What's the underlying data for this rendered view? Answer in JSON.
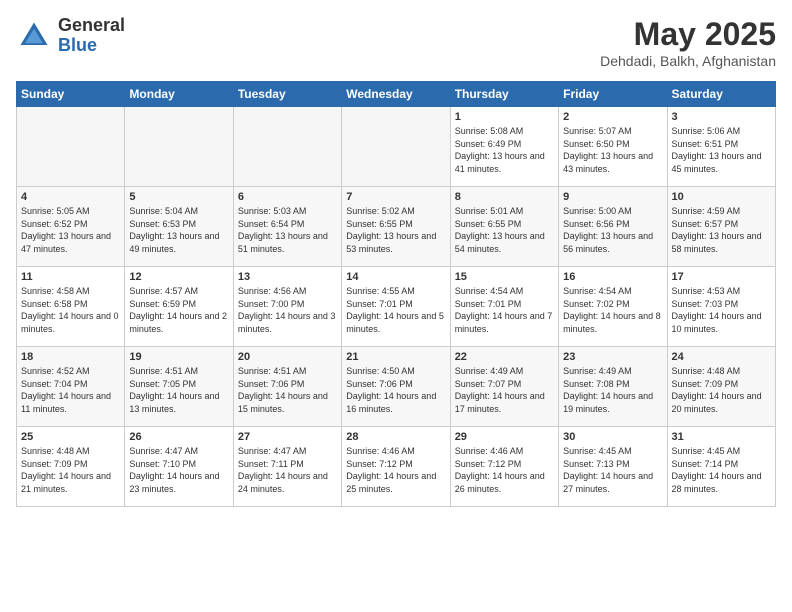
{
  "header": {
    "logo_general": "General",
    "logo_blue": "Blue",
    "title": "May 2025",
    "subtitle": "Dehdadi, Balkh, Afghanistan"
  },
  "weekdays": [
    "Sunday",
    "Monday",
    "Tuesday",
    "Wednesday",
    "Thursday",
    "Friday",
    "Saturday"
  ],
  "weeks": [
    [
      {
        "day": "",
        "empty": true
      },
      {
        "day": "",
        "empty": true
      },
      {
        "day": "",
        "empty": true
      },
      {
        "day": "",
        "empty": true
      },
      {
        "day": "1",
        "sunrise": "5:08 AM",
        "sunset": "6:49 PM",
        "daylight": "13 hours and 41 minutes."
      },
      {
        "day": "2",
        "sunrise": "5:07 AM",
        "sunset": "6:50 PM",
        "daylight": "13 hours and 43 minutes."
      },
      {
        "day": "3",
        "sunrise": "5:06 AM",
        "sunset": "6:51 PM",
        "daylight": "13 hours and 45 minutes."
      }
    ],
    [
      {
        "day": "4",
        "sunrise": "5:05 AM",
        "sunset": "6:52 PM",
        "daylight": "13 hours and 47 minutes."
      },
      {
        "day": "5",
        "sunrise": "5:04 AM",
        "sunset": "6:53 PM",
        "daylight": "13 hours and 49 minutes."
      },
      {
        "day": "6",
        "sunrise": "5:03 AM",
        "sunset": "6:54 PM",
        "daylight": "13 hours and 51 minutes."
      },
      {
        "day": "7",
        "sunrise": "5:02 AM",
        "sunset": "6:55 PM",
        "daylight": "13 hours and 53 minutes."
      },
      {
        "day": "8",
        "sunrise": "5:01 AM",
        "sunset": "6:55 PM",
        "daylight": "13 hours and 54 minutes."
      },
      {
        "day": "9",
        "sunrise": "5:00 AM",
        "sunset": "6:56 PM",
        "daylight": "13 hours and 56 minutes."
      },
      {
        "day": "10",
        "sunrise": "4:59 AM",
        "sunset": "6:57 PM",
        "daylight": "13 hours and 58 minutes."
      }
    ],
    [
      {
        "day": "11",
        "sunrise": "4:58 AM",
        "sunset": "6:58 PM",
        "daylight": "14 hours and 0 minutes."
      },
      {
        "day": "12",
        "sunrise": "4:57 AM",
        "sunset": "6:59 PM",
        "daylight": "14 hours and 2 minutes."
      },
      {
        "day": "13",
        "sunrise": "4:56 AM",
        "sunset": "7:00 PM",
        "daylight": "14 hours and 3 minutes."
      },
      {
        "day": "14",
        "sunrise": "4:55 AM",
        "sunset": "7:01 PM",
        "daylight": "14 hours and 5 minutes."
      },
      {
        "day": "15",
        "sunrise": "4:54 AM",
        "sunset": "7:01 PM",
        "daylight": "14 hours and 7 minutes."
      },
      {
        "day": "16",
        "sunrise": "4:54 AM",
        "sunset": "7:02 PM",
        "daylight": "14 hours and 8 minutes."
      },
      {
        "day": "17",
        "sunrise": "4:53 AM",
        "sunset": "7:03 PM",
        "daylight": "14 hours and 10 minutes."
      }
    ],
    [
      {
        "day": "18",
        "sunrise": "4:52 AM",
        "sunset": "7:04 PM",
        "daylight": "14 hours and 11 minutes."
      },
      {
        "day": "19",
        "sunrise": "4:51 AM",
        "sunset": "7:05 PM",
        "daylight": "14 hours and 13 minutes."
      },
      {
        "day": "20",
        "sunrise": "4:51 AM",
        "sunset": "7:06 PM",
        "daylight": "14 hours and 15 minutes."
      },
      {
        "day": "21",
        "sunrise": "4:50 AM",
        "sunset": "7:06 PM",
        "daylight": "14 hours and 16 minutes."
      },
      {
        "day": "22",
        "sunrise": "4:49 AM",
        "sunset": "7:07 PM",
        "daylight": "14 hours and 17 minutes."
      },
      {
        "day": "23",
        "sunrise": "4:49 AM",
        "sunset": "7:08 PM",
        "daylight": "14 hours and 19 minutes."
      },
      {
        "day": "24",
        "sunrise": "4:48 AM",
        "sunset": "7:09 PM",
        "daylight": "14 hours and 20 minutes."
      }
    ],
    [
      {
        "day": "25",
        "sunrise": "4:48 AM",
        "sunset": "7:09 PM",
        "daylight": "14 hours and 21 minutes."
      },
      {
        "day": "26",
        "sunrise": "4:47 AM",
        "sunset": "7:10 PM",
        "daylight": "14 hours and 23 minutes."
      },
      {
        "day": "27",
        "sunrise": "4:47 AM",
        "sunset": "7:11 PM",
        "daylight": "14 hours and 24 minutes."
      },
      {
        "day": "28",
        "sunrise": "4:46 AM",
        "sunset": "7:12 PM",
        "daylight": "14 hours and 25 minutes."
      },
      {
        "day": "29",
        "sunrise": "4:46 AM",
        "sunset": "7:12 PM",
        "daylight": "14 hours and 26 minutes."
      },
      {
        "day": "30",
        "sunrise": "4:45 AM",
        "sunset": "7:13 PM",
        "daylight": "14 hours and 27 minutes."
      },
      {
        "day": "31",
        "sunrise": "4:45 AM",
        "sunset": "7:14 PM",
        "daylight": "14 hours and 28 minutes."
      }
    ]
  ]
}
